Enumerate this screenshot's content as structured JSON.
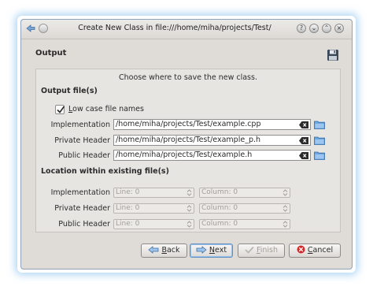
{
  "window": {
    "title": "Create New Class in file:///home/miha/projects/Test/",
    "controls": [
      "help-icon",
      "minimize-icon",
      "maximize-icon",
      "close-icon"
    ]
  },
  "page": {
    "title": "Output",
    "description": "Choose where to save the new class."
  },
  "output_files": {
    "section_title": "Output file(s)",
    "lowercase": {
      "label": "Low case file names",
      "checked": true
    },
    "rows": [
      {
        "label": "Implementation",
        "value": "/home/miha/projects/Test/example.cpp"
      },
      {
        "label": "Private Header",
        "value": "/home/miha/projects/Test/example_p.h"
      },
      {
        "label": "Public Header",
        "value": "/home/miha/projects/Test/example.h"
      }
    ]
  },
  "location": {
    "section_title": "Location within existing file(s)",
    "rows": [
      {
        "label": "Implementation",
        "line": "Line: 0",
        "column": "Column: 0"
      },
      {
        "label": "Private Header",
        "line": "Line: 0",
        "column": "Column: 0"
      },
      {
        "label": "Public Header",
        "line": "Line: 0",
        "column": "Column: 0"
      }
    ]
  },
  "buttons": {
    "back": "Back",
    "next": "Next",
    "finish": "Finish",
    "cancel": "Cancel"
  },
  "colors": {
    "glow": "#6eb4eb",
    "window_bg": "#dfdcd8",
    "panel_bg": "#e7e5e2",
    "cancel_red": "#d22a2a",
    "next_focus": "#5f8ec2"
  }
}
